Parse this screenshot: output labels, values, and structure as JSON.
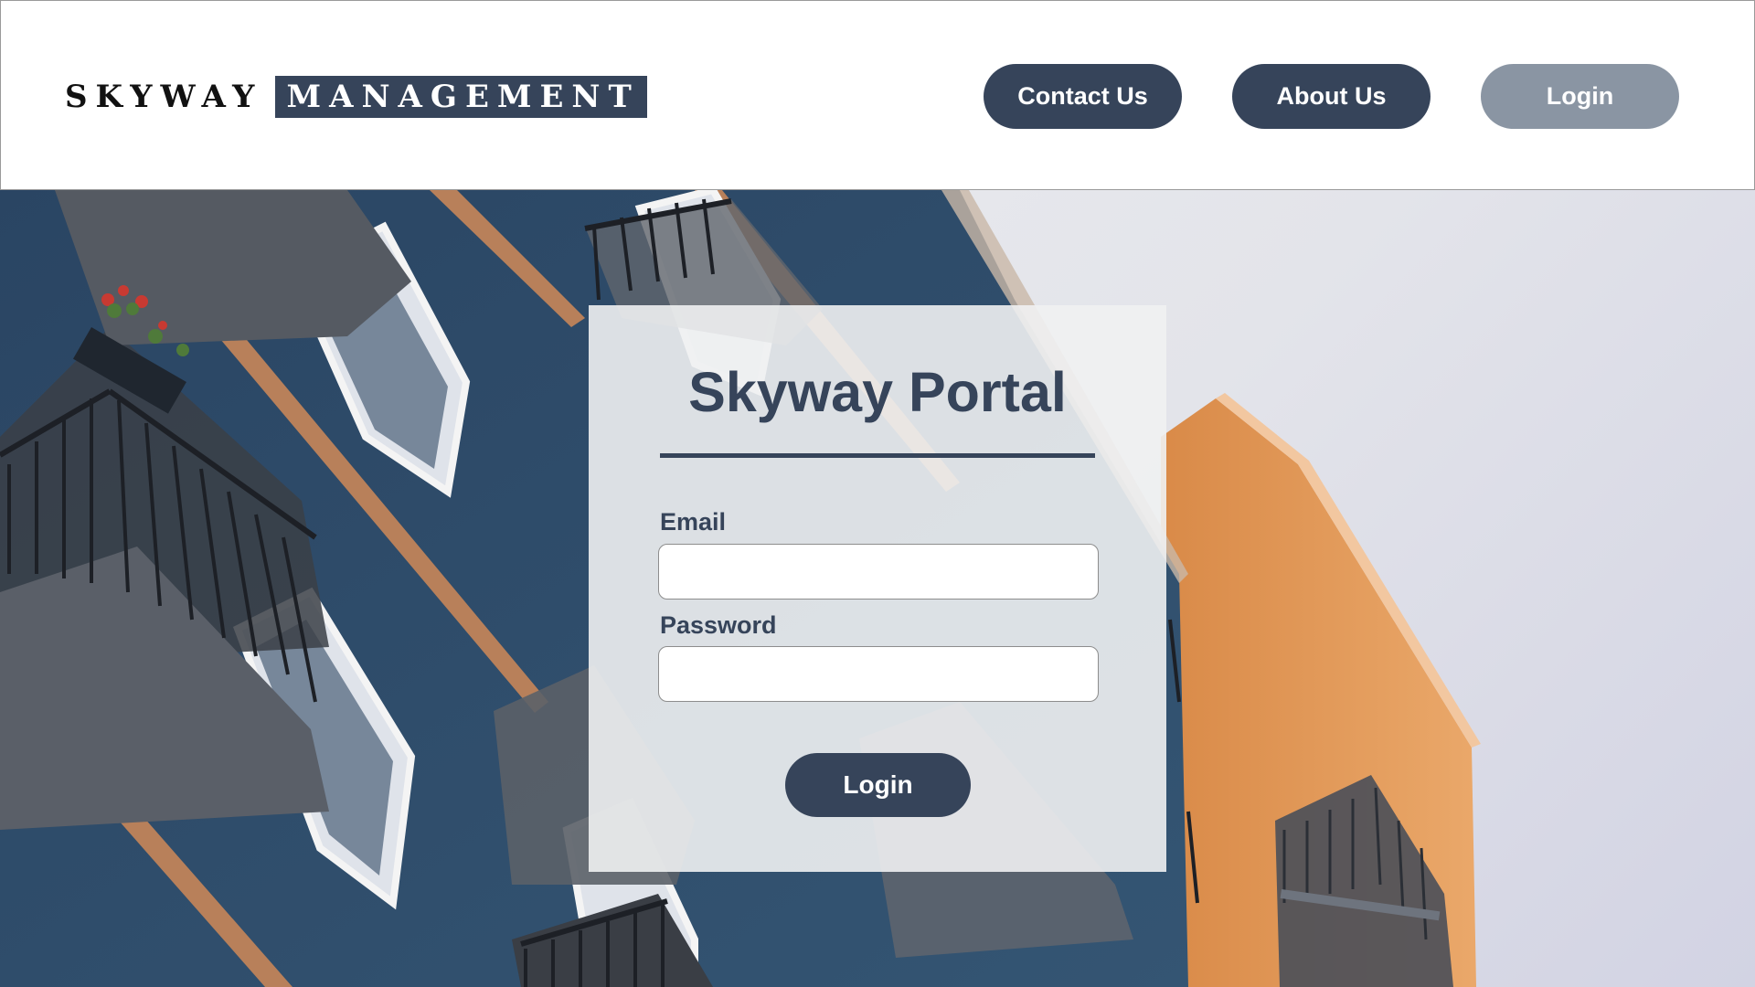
{
  "header": {
    "logo_word1": "SKYWAY",
    "logo_word2": "MANAGEMENT",
    "nav": {
      "contact_label": "Contact Us",
      "about_label": "About Us",
      "login_label": "Login"
    }
  },
  "login_card": {
    "title": "Skyway Portal",
    "email_label": "Email",
    "email_value": "",
    "password_label": "Password",
    "password_value": "",
    "submit_label": "Login"
  },
  "colors": {
    "brand_navy": "#36445a",
    "nav_login_muted": "#8a95a3",
    "building_blue": "#2e4a66",
    "building_orange": "#e09a5a"
  }
}
